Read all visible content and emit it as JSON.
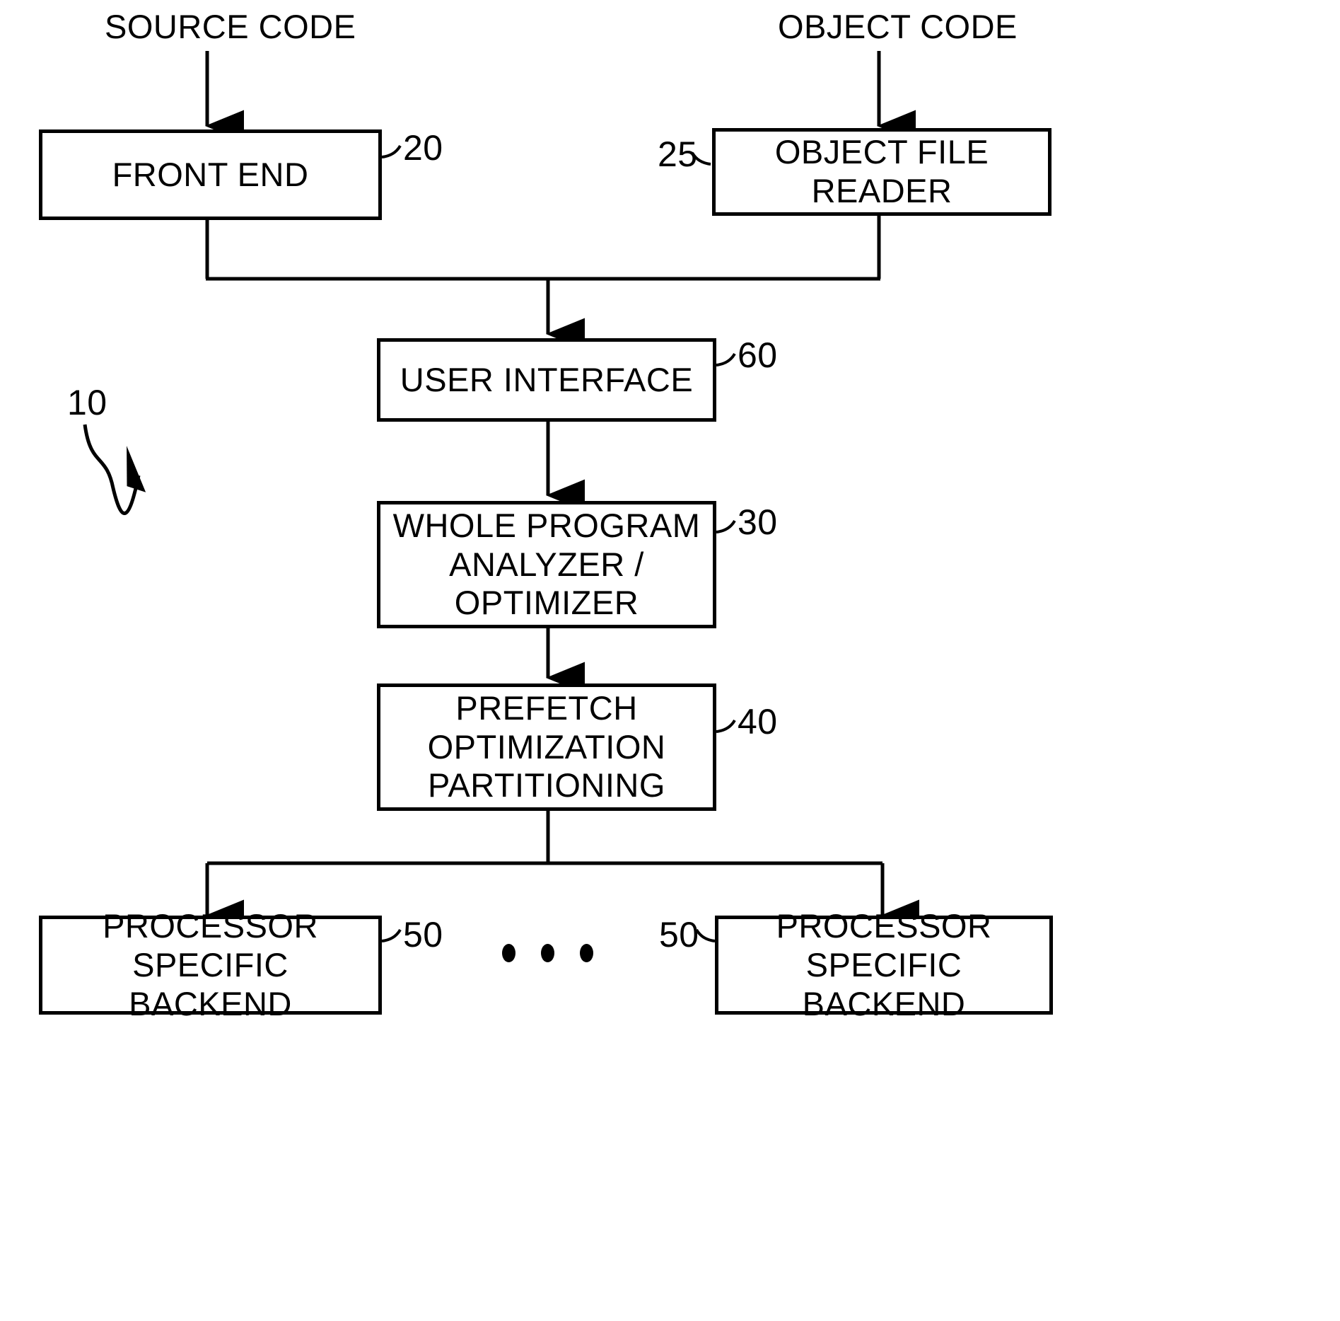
{
  "figure": {
    "type": "patent-block-diagram",
    "system_reference_number": "10"
  },
  "inputs": [
    {
      "id": "source-code",
      "label": "SOURCE CODE"
    },
    {
      "id": "object-code",
      "label": "OBJECT CODE"
    }
  ],
  "nodes": [
    {
      "id": "front-end",
      "label": "FRONT END",
      "ref": "20",
      "ref_side": "right"
    },
    {
      "id": "object-file-reader",
      "label": "OBJECT FILE READER",
      "ref": "25",
      "ref_side": "left"
    },
    {
      "id": "user-interface",
      "label": "USER INTERFACE",
      "ref": "60",
      "ref_side": "right"
    },
    {
      "id": "whole-program-analyzer",
      "label": "WHOLE PROGRAM\nANALYZER /\nOPTIMIZER",
      "ref": "30",
      "ref_side": "right"
    },
    {
      "id": "prefetch-optimization",
      "label": "PREFETCH\nOPTIMIZATION\nPARTITIONING",
      "ref": "40",
      "ref_side": "right"
    },
    {
      "id": "backend-left",
      "label": "PROCESSOR SPECIFIC\nBACKEND",
      "ref": "50",
      "ref_side": "right"
    },
    {
      "id": "backend-right",
      "label": "PROCESSOR SPECIFIC\nBACKEND",
      "ref": "50",
      "ref_side": "left"
    }
  ],
  "ellipsis": {
    "label": "• • •",
    "dot_count": 3
  },
  "colors": {
    "stroke": "#000000",
    "fill": "#ffffff",
    "text": "#000000"
  }
}
